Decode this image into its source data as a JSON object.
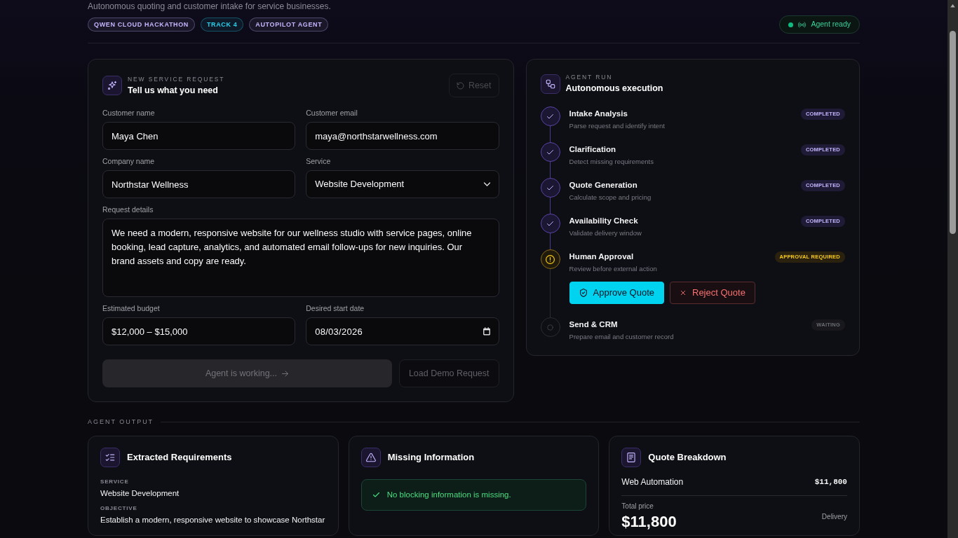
{
  "header": {
    "subtitle": "Autonomous quoting and customer intake for service businesses.",
    "tags": [
      {
        "label": "QWEN CLOUD HACKATHON",
        "color": "#c4b5fd"
      },
      {
        "label": "TRACK 4",
        "color": "#22d3ee"
      },
      {
        "label": "AUTOPILOT AGENT",
        "color": "#c4b5fd"
      }
    ],
    "status": {
      "label": "Agent ready",
      "online": true
    }
  },
  "request_form": {
    "eyebrow": "NEW SERVICE REQUEST",
    "title": "Tell us what you need",
    "reset_button": {
      "label": "Reset",
      "disabled": true
    },
    "fields": [
      {
        "label": "Customer name",
        "kind": "text",
        "value": "Maya Chen"
      },
      {
        "label": "Customer email",
        "kind": "text",
        "value": "maya@northstarwellness.com"
      },
      {
        "label": "Company name",
        "kind": "text",
        "value": "Northstar Wellness"
      },
      {
        "label": "Service",
        "kind": "select",
        "value": "Website Development"
      },
      {
        "label": "Request details",
        "kind": "textarea",
        "value": "We need a modern, responsive website for our wellness studio with service pages, online booking, lead capture, analytics, and automated email follow-ups for new inquiries. Our brand assets and copy are ready."
      },
      {
        "label": "Estimated budget",
        "kind": "text",
        "value": "$12,000 – $15,000"
      },
      {
        "label": "Desired start date",
        "kind": "date",
        "value": "08/03/2026"
      }
    ],
    "submit_button": {
      "label": "Agent is working...",
      "disabled": true
    },
    "demo_button": {
      "label": "Load Demo Request",
      "disabled": true
    }
  },
  "agent_run": {
    "eyebrow": "AGENT RUN",
    "title": "Autonomous execution",
    "steps": [
      {
        "title": "Intake Analysis",
        "description": "Parse request and identify intent",
        "kind": "completed",
        "badge": "COMPLETED"
      },
      {
        "title": "Clarification",
        "description": "Detect missing requirements",
        "kind": "completed",
        "badge": "COMPLETED"
      },
      {
        "title": "Quote Generation",
        "description": "Calculate scope and pricing",
        "kind": "completed",
        "badge": "COMPLETED"
      },
      {
        "title": "Availability Check",
        "description": "Validate delivery window",
        "kind": "completed",
        "badge": "COMPLETED"
      },
      {
        "title": "Human Approval",
        "description": "Review before external action",
        "kind": "approval",
        "badge": "APPROVAL REQUIRED",
        "actions": [
          {
            "label": "Approve Quote",
            "kind": "approve"
          },
          {
            "label": "Reject Quote",
            "kind": "reject"
          }
        ]
      },
      {
        "title": "Send & CRM",
        "description": "Prepare email and customer record",
        "kind": "waiting",
        "badge": "WAITING"
      }
    ]
  },
  "agent_output": {
    "label": "AGENT OUTPUT",
    "cards": [
      {
        "kind": "requirements",
        "title": "Extracted Requirements",
        "items": [
          {
            "label": "SERVICE",
            "value": "Website Development"
          },
          {
            "label": "OBJECTIVE",
            "value": "Establish a modern, responsive website to showcase Northstar"
          }
        ]
      },
      {
        "kind": "missing",
        "title": "Missing Information",
        "notice": "No blocking information is missing."
      },
      {
        "kind": "quote",
        "title": "Quote Breakdown",
        "line_items": [
          {
            "name": "Web Automation",
            "amount": "$11,800"
          }
        ],
        "total_label": "Total price",
        "total": "$11,800",
        "delivery_label": "Delivery"
      }
    ]
  }
}
